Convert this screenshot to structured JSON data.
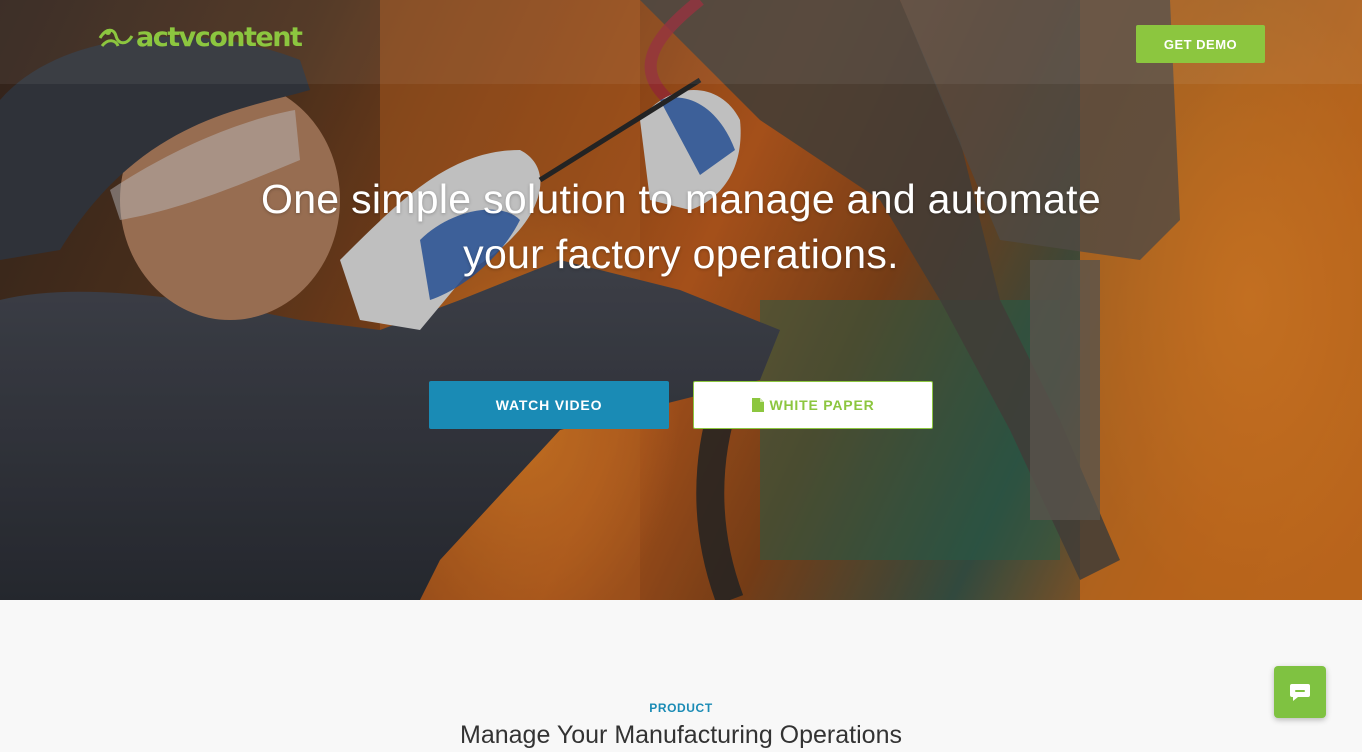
{
  "brand": {
    "name": "actvcontent",
    "primary_green": "#8cc63f",
    "accent_blue": "#1a8bb5"
  },
  "header": {
    "demo_label": "GET DEMO"
  },
  "hero": {
    "headline": "One simple solution to manage and automate your factory operations.",
    "watch_label": "WATCH VIDEO",
    "paper_label": "WHITE PAPER",
    "paper_icon": "document-icon"
  },
  "section": {
    "eyebrow": "PRODUCT",
    "title": "Manage Your Manufacturing Operations"
  },
  "chat": {
    "icon": "chat-bubble-icon"
  }
}
